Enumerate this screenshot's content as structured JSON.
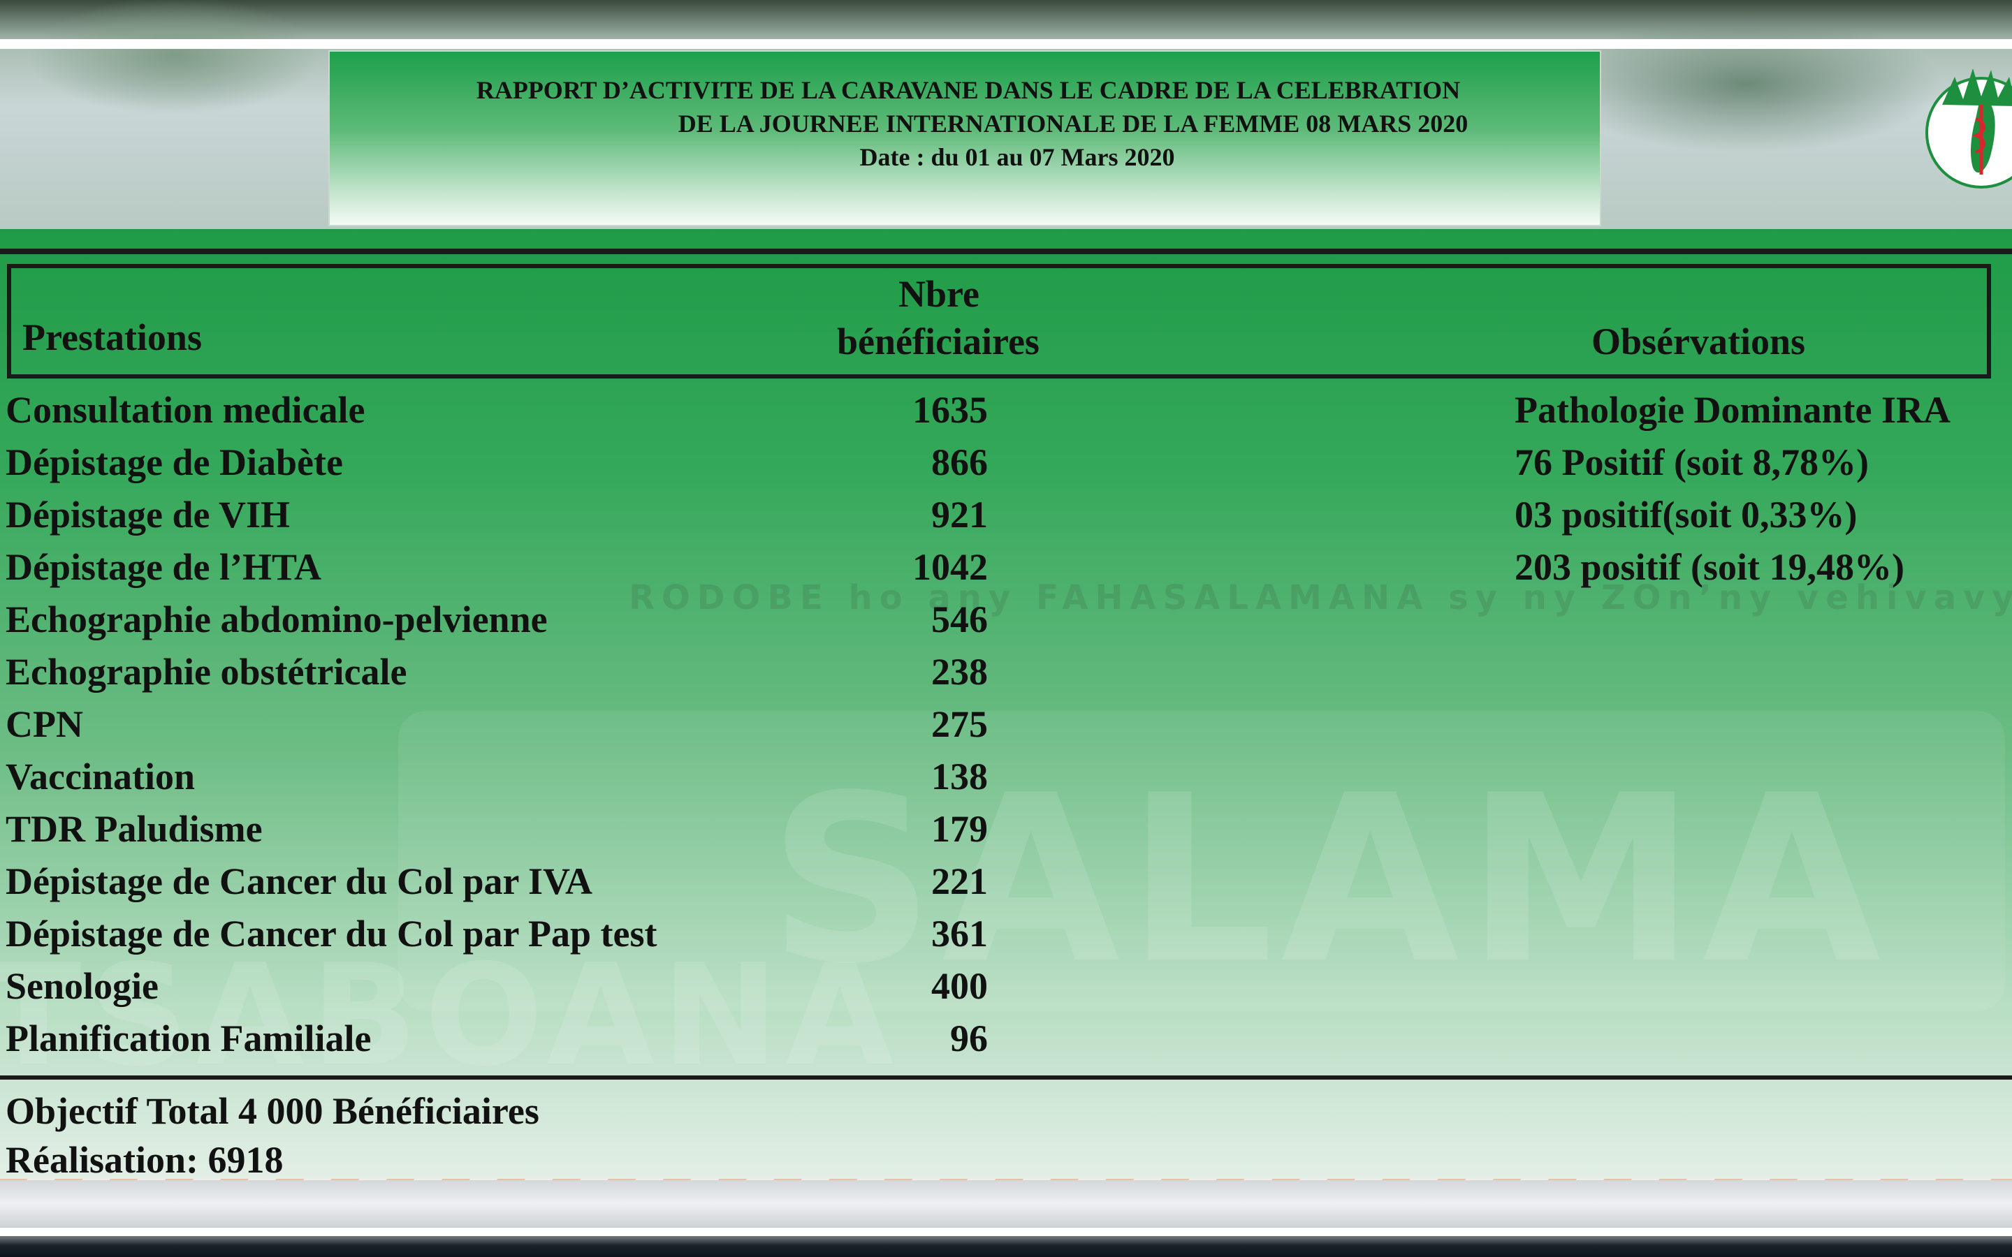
{
  "title": {
    "line1": "RAPPORT D’ACTIVITE DE LA CARAVANE DANS LE CADRE DE LA CELEBRATION",
    "line2": "DE LA JOURNEE INTERNATIONALE DE LA FEMME 08 MARS 2020",
    "line3": "Date : du 01 au 07 Mars 2020"
  },
  "table": {
    "headers": {
      "prestations": "Prestations",
      "nbre_line1": "Nbre",
      "nbre_line2": "bénéficiaires",
      "observations": "Obsérvations"
    },
    "rows": [
      {
        "prestation": "Consultation medicale",
        "nombre": "1635",
        "observation": "Pathologie Dominante IRA"
      },
      {
        "prestation": "Dépistage de Diabète",
        "nombre": "866",
        "observation": "76 Positif (soit 8,78%)"
      },
      {
        "prestation": "Dépistage de VIH",
        "nombre": "921",
        "observation": "03 positif(soit 0,33%)"
      },
      {
        "prestation": "Dépistage de l’HTA",
        "nombre": "1042",
        "observation": "203 positif  (soit 19,48%)"
      },
      {
        "prestation": "Echographie abdomino-pelvienne",
        "nombre": "546",
        "observation": ""
      },
      {
        "prestation": "Echographie obstétricale",
        "nombre": "238",
        "observation": ""
      },
      {
        "prestation": "CPN",
        "nombre": "275",
        "observation": ""
      },
      {
        "prestation": "Vaccination",
        "nombre": "138",
        "observation": ""
      },
      {
        "prestation": "TDR Paludisme",
        "nombre": "179",
        "observation": ""
      },
      {
        "prestation": "Dépistage de Cancer du Col par IVA",
        "nombre": "221",
        "observation": ""
      },
      {
        "prestation": "Dépistage de Cancer du Col par  Pap test",
        "nombre": "361",
        "observation": ""
      },
      {
        "prestation": "Senologie",
        "nombre": "400",
        "observation": ""
      },
      {
        "prestation": "Planification Familiale",
        "nombre": "96",
        "observation": ""
      }
    ]
  },
  "summary": {
    "objectif": "Objectif  Total  4 000 Bénéficiaires",
    "realisation": "Réalisation: 6918"
  },
  "background_text": {
    "banner": "RODOBE ho any FAHASALAMANA sy ny ZOn’ny vehivavy",
    "big1": "SALAMA",
    "big2": "TSABOANA"
  },
  "colors": {
    "panel_green": "#1f9b47",
    "text": "#111111"
  },
  "icons": {
    "logo": "ministry-health-madagascar-logo"
  }
}
